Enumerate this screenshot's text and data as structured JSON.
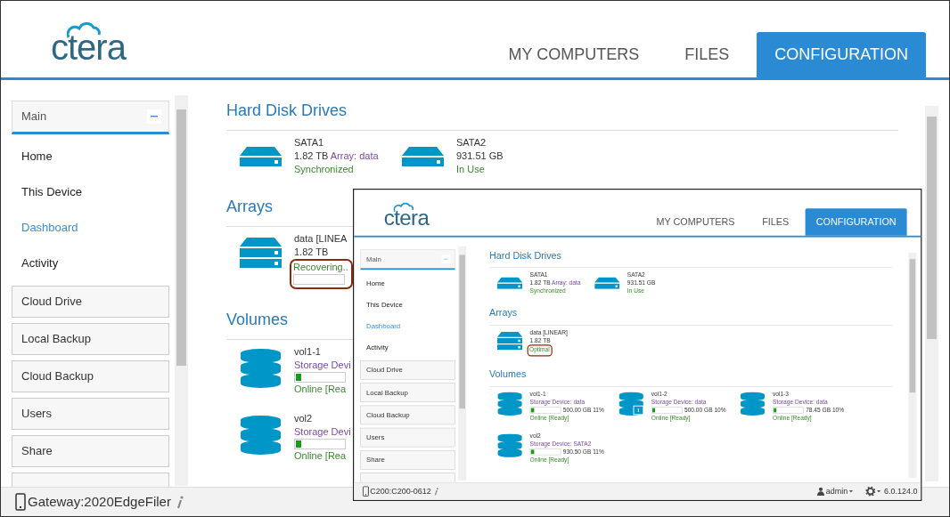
{
  "screen": {
    "logo": "ctera",
    "tabs": [
      {
        "label": "MY COMPUTERS",
        "selected": false
      },
      {
        "label": "FILES",
        "selected": false
      },
      {
        "label": "CONFIGURATION",
        "selected": true
      }
    ],
    "sidebar": {
      "header": "Main",
      "items": [
        {
          "label": "Home",
          "kind": "link",
          "selected": false
        },
        {
          "label": "This Device",
          "kind": "link",
          "selected": false
        },
        {
          "label": "Dashboard",
          "kind": "link",
          "selected": true
        },
        {
          "label": "Activity",
          "kind": "link",
          "selected": false
        },
        {
          "label": "Cloud Drive",
          "kind": "box",
          "selected": false
        },
        {
          "label": "Local Backup",
          "kind": "box",
          "selected": false
        },
        {
          "label": "Cloud Backup",
          "kind": "box",
          "selected": false
        },
        {
          "label": "Users",
          "kind": "box",
          "selected": false
        },
        {
          "label": "Share",
          "kind": "box",
          "selected": false
        },
        {
          "kind": "stub",
          "selected": false
        }
      ]
    },
    "sections": [
      {
        "title": "Hard Disk Drives",
        "rows": [
          [
            {
              "kind": "drive",
              "name": "SATA1",
              "size": "1.82 TB",
              "array": "Array: data",
              "status": "Synchronized"
            },
            {
              "kind": "drive",
              "name": "SATA2",
              "size": "931.51 GB",
              "status": "In Use"
            }
          ]
        ]
      },
      {
        "title": "Arrays",
        "rows": [
          [
            {
              "kind": "array",
              "name": "data [LINEA",
              "size": "1.82 TB",
              "status": "Recovering..",
              "highlighted": true,
              "level": 0
            }
          ]
        ]
      },
      {
        "title": "Volumes",
        "rows": [
          [
            {
              "kind": "volume",
              "name": "vol1-1",
              "device": "Storage Devi",
              "level": 0.11,
              "status": "Online [Rea",
              "locked": false
            }
          ],
          [
            {
              "kind": "volume",
              "name": "vol2",
              "device": "Storage Devi",
              "level": 0.11,
              "status": "Online [Rea",
              "locked": false
            }
          ]
        ]
      }
    ],
    "status_bar": {
      "device": "Gateway:2020EdgeFiler"
    }
  },
  "inset_window": {
    "logo": "ctera",
    "tabs": [
      {
        "label": "MY COMPUTERS",
        "selected": false
      },
      {
        "label": "FILES",
        "selected": false
      },
      {
        "label": "CONFIGURATION",
        "selected": true
      }
    ],
    "sidebar": {
      "header": "Main",
      "items": [
        {
          "label": "Home",
          "kind": "link",
          "selected": false
        },
        {
          "label": "This Device",
          "kind": "link",
          "selected": false
        },
        {
          "label": "Dashboard",
          "kind": "link",
          "selected": true
        },
        {
          "label": "Activity",
          "kind": "link",
          "selected": false
        },
        {
          "label": "Cloud Drive",
          "kind": "box",
          "selected": false
        },
        {
          "label": "Local Backup",
          "kind": "box",
          "selected": false
        },
        {
          "label": "Cloud Backup",
          "kind": "box",
          "selected": false
        },
        {
          "label": "Users",
          "kind": "box",
          "selected": false
        },
        {
          "label": "Share",
          "kind": "box",
          "selected": false
        },
        {
          "kind": "stub",
          "selected": false
        }
      ]
    },
    "sections": [
      {
        "title": "Hard Disk Drives",
        "rows": [
          [
            {
              "kind": "drive",
              "name": "SATA1",
              "size": "1.82 TB",
              "array": "Array: data",
              "status": "Synchronized"
            },
            {
              "kind": "drive",
              "name": "SATA2",
              "size": "931.51 GB",
              "status": "In Use"
            }
          ]
        ]
      },
      {
        "title": "Arrays",
        "rows": [
          [
            {
              "kind": "array",
              "name": "data [LINEAR]",
              "size": "1.82 TB",
              "status": "Optimal",
              "highlighted": true
            }
          ]
        ]
      },
      {
        "title": "Volumes",
        "rows": [
          [
            {
              "kind": "volume",
              "name": "vol1-1",
              "device": "Storage Device: data",
              "level": 0.11,
              "reading": "500.00 GB 11%",
              "status": "Online [Ready]",
              "locked": false
            },
            {
              "kind": "volume",
              "name": "vol1-2",
              "device": "Storage Device: data",
              "level": 0.1,
              "reading": "500.00 GB 10%",
              "status": "Online [Ready]",
              "locked": true
            },
            {
              "kind": "volume",
              "name": "vol1-3",
              "device": "Storage Device: data",
              "level": 0.1,
              "reading": "78.45 GB 10%",
              "status": "Online [Ready]",
              "locked": false
            }
          ],
          [
            {
              "kind": "volume",
              "name": "vol2",
              "device": "Storage Device: SATA2",
              "level": 0.11,
              "reading": "930.50 GB 11%",
              "status": "Online [Ready]",
              "locked": false
            }
          ]
        ]
      }
    ],
    "status_bar": {
      "device": "C200:C200-0612",
      "user": "admin",
      "version": "6.0.124.0"
    }
  }
}
